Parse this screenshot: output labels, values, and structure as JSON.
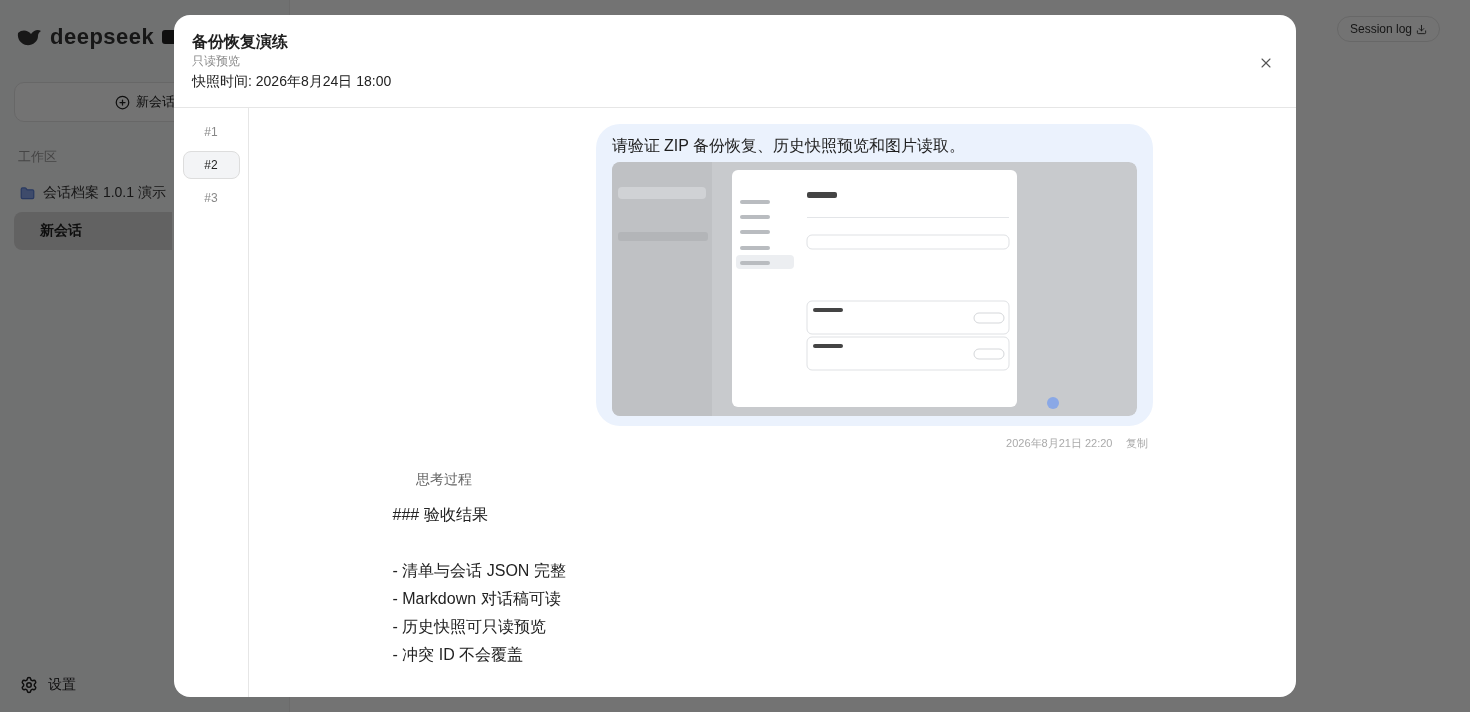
{
  "app": {
    "logo": "deepseek",
    "new_chat_button": "新会话",
    "section_label": "工作区",
    "folders": [
      {
        "name": "会话档案 1.0.1 演示",
        "children": [
          {
            "title": "新会话",
            "selected": true
          }
        ]
      }
    ],
    "settings": "设置",
    "session_log_button": "Session log"
  },
  "dialog": {
    "title": "备份恢复演练",
    "subtitle": "只读预览",
    "snapshot_time": "快照时间: 2026年8月24日 18:00",
    "turns": [
      {
        "label": "#1",
        "selected": false
      },
      {
        "label": "#2",
        "selected": true
      },
      {
        "label": "#3",
        "selected": false
      }
    ],
    "message": {
      "text": "请验证 ZIP 备份恢复、历史快照预览和图片读取。",
      "time": "2026年8月21日 22:20",
      "copy": "复制"
    },
    "reasoning_label": "思考过程",
    "answer": {
      "heading": "### 验收结果",
      "lines": [
        "- 清单与会话 JSON 完整",
        "- Markdown 对话稿可读",
        "- 历史快照可只读预览",
        "- 冲突 ID 不会覆盖"
      ]
    }
  }
}
